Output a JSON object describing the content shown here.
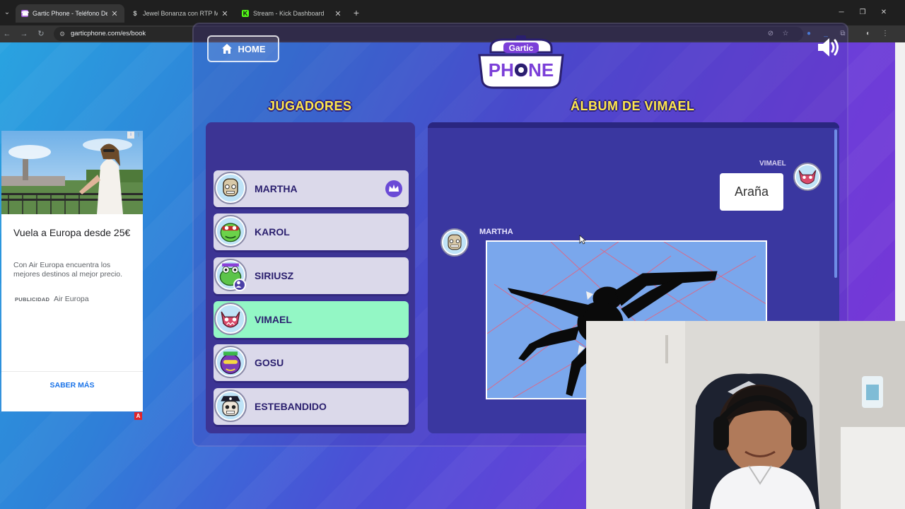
{
  "browser": {
    "tabs": [
      {
        "title": "Gartic Phone - Teléfono Descon",
        "favicon": "gartic-favicon",
        "active": true
      },
      {
        "title": "Jewel Bonanza con RTP Mejora",
        "favicon": "dollar-favicon",
        "active": false
      },
      {
        "title": "Stream - Kick Dashboard",
        "favicon": "kick-favicon",
        "active": false
      }
    ],
    "url": "garticphone.com/es/book"
  },
  "game": {
    "home_label": "HOME",
    "players_title": "JUGADORES",
    "album_title": "ÁLBUM DE VIMAEL",
    "players": [
      {
        "name": "MARTHA",
        "host": true,
        "active": false
      },
      {
        "name": "KAROL",
        "host": false,
        "active": false
      },
      {
        "name": "SIRIUSZ",
        "host": false,
        "active": false
      },
      {
        "name": "VIMAEL",
        "host": false,
        "active": true
      },
      {
        "name": "GOSU",
        "host": false,
        "active": false
      },
      {
        "name": "ESTEBANDIDO",
        "host": false,
        "active": false
      }
    ],
    "album": {
      "top_author": "VIMAEL",
      "guess_text": "Araña",
      "drawing_author": "MARTHA"
    },
    "colors": {
      "active_player": "#93f7c5",
      "player": "#dbd9ea",
      "title": "#ffe74a"
    }
  },
  "ad": {
    "title": "Vuela a Europa desde 25€",
    "description": "Con Air Europa encuentra los mejores destinos al mejor precio.",
    "tag": "PUBLICIDAD",
    "sponsor": "Air Europa",
    "cta": "SABER MÁS"
  }
}
